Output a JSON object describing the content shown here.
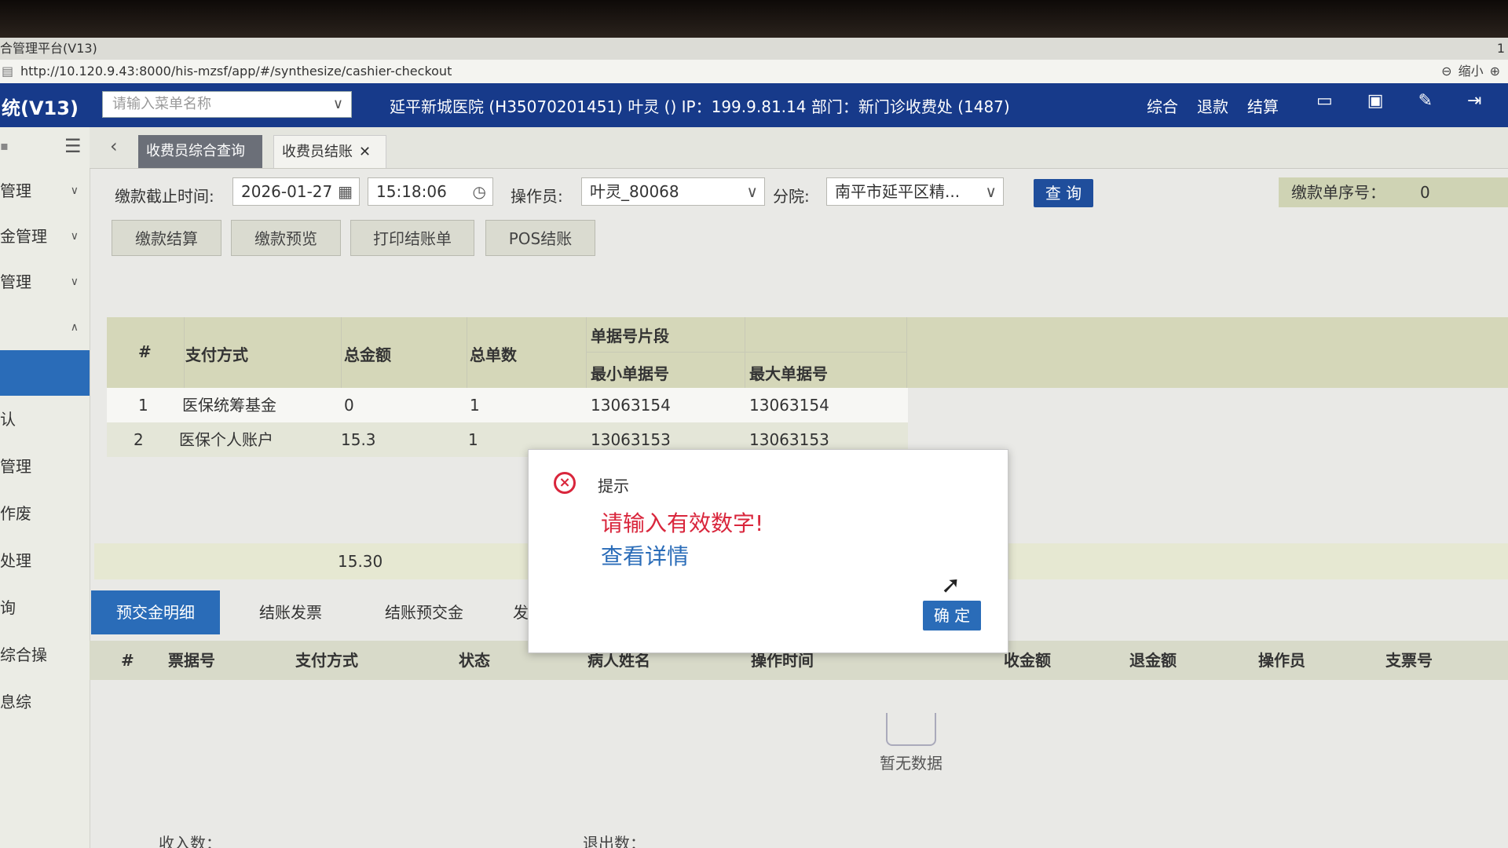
{
  "browser": {
    "window_title": "合管理平台(V13)",
    "right_num": "1",
    "url": "http://10.120.9.43:8000/his-mzsf/app/#/synthesize/cashier-checkout",
    "zoom_label": "缩小"
  },
  "header": {
    "app_title": "统(V13)",
    "menu_search_placeholder": "请输入菜单名称",
    "hospital_info": "延平新城医院 (H35070201451) 叶灵 () IP：199.9.81.14 部门：新门诊收费处 (1487)",
    "links": [
      "综合",
      "退款",
      "结算"
    ]
  },
  "sidebar": {
    "items": [
      "管理",
      "金管理",
      "管理"
    ],
    "sub_items": [
      "认",
      "管理",
      "作废",
      "处理",
      "询",
      "综合操",
      "息综"
    ]
  },
  "tabs": [
    {
      "label": "收费员综合查询"
    },
    {
      "label": "收费员结账"
    }
  ],
  "filters": {
    "deadline_label": "缴款截止时间:",
    "date": "2026-01-27",
    "time": "15:18:06",
    "operator_label": "操作员:",
    "operator": "叶灵_80068",
    "branch_label": "分院:",
    "branch": "南平市延平区精...",
    "query_button": "查 询",
    "seq_label": "缴款单序号：",
    "seq_value": "0"
  },
  "actions": [
    "缴款结算",
    "缴款预览",
    "打印结账单",
    "POS结账"
  ],
  "summary_table": {
    "headers": {
      "index": "#",
      "pay_method": "支付方式",
      "total_amount": "总金额",
      "total_count": "总单数",
      "range": "单据号片段",
      "min": "最小单据号",
      "max": "最大单据号"
    },
    "rows": [
      {
        "index": "1",
        "pay_method": "医保统筹基金",
        "total_amount": "0",
        "total_count": "1",
        "min": "13063154",
        "max": "13063154"
      },
      {
        "index": "2",
        "pay_method": "医保个人账户",
        "total_amount": "15.3",
        "total_count": "1",
        "min": "13063153",
        "max": "13063153"
      }
    ],
    "total": "15.30"
  },
  "bottom_tabs": [
    "预交金明细",
    "结账发票",
    "结账预交金",
    "发"
  ],
  "detail_headers": [
    "#",
    "票据号",
    "支付方式",
    "状态",
    "病人姓名",
    "操作时间",
    "收金额",
    "退金额",
    "操作员",
    "支票号"
  ],
  "empty_text": "暂无数据",
  "footer": {
    "income_label": "收入数：",
    "refund_label": "退出数："
  },
  "dialog": {
    "title": "提示",
    "message": "请输入有效数字!",
    "detail_link": "查看详情",
    "ok_button": "确 定"
  },
  "colors": {
    "header_bg": "#173a8a",
    "accent": "#2a6cb8",
    "error": "#d9263c"
  }
}
